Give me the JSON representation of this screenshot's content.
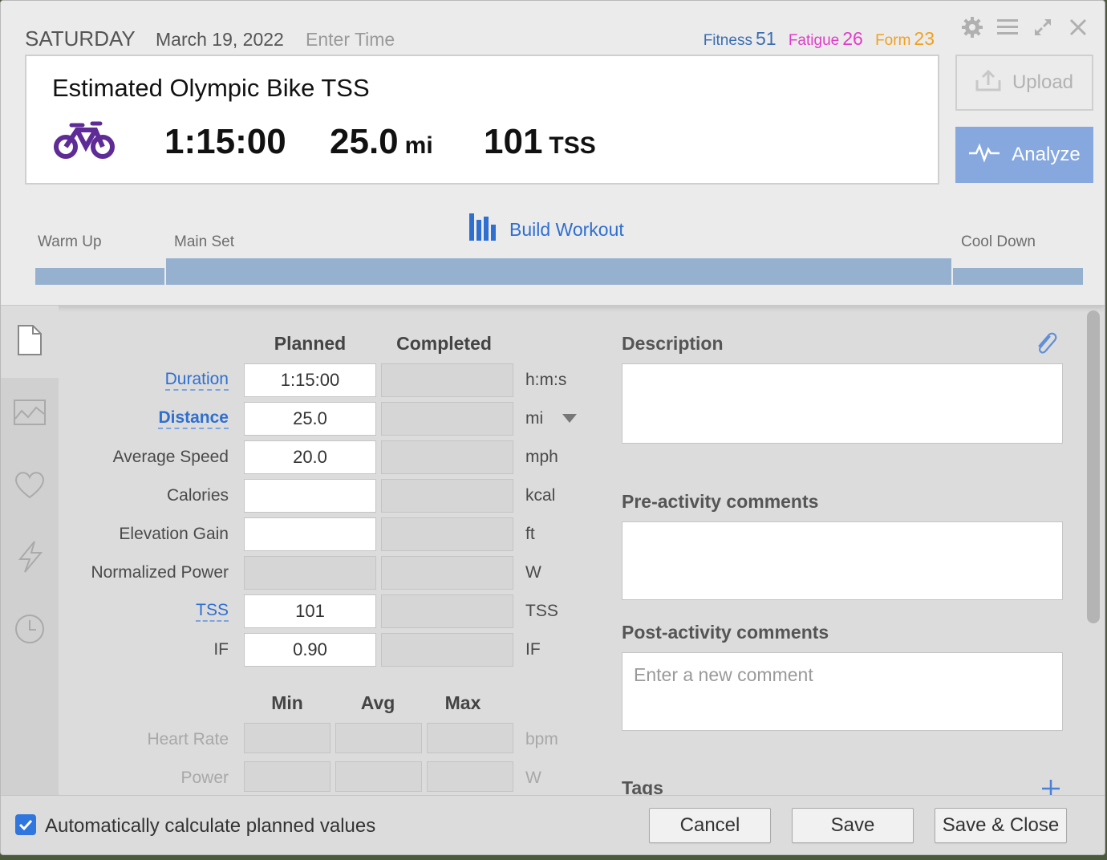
{
  "header": {
    "day_name": "SATURDAY",
    "date": "March 19, 2022",
    "time_placeholder": "Enter Time",
    "metrics": {
      "fitness_label": "Fitness",
      "fitness_value": "51",
      "fatigue_label": "Fatigue",
      "fatigue_value": "26",
      "form_label": "Form",
      "form_value": "23"
    },
    "colors": {
      "fitness": "#3b6db3",
      "fatigue": "#e03cc8",
      "form": "#f0a020"
    }
  },
  "summary": {
    "title": "Estimated Olympic Bike TSS",
    "duration": "1:15:00",
    "distance_value": "25.0",
    "distance_unit": "mi",
    "tss_value": "101",
    "tss_unit": "TSS",
    "sport_icon": "bike-icon",
    "sport_color": "#5e2b97"
  },
  "buttons": {
    "upload": "Upload",
    "analyze": "Analyze"
  },
  "build": {
    "link": "Build Workout",
    "segments": {
      "warm_up": "Warm Up",
      "main_set": "Main Set",
      "cool_down": "Cool Down"
    }
  },
  "table": {
    "planned_header": "Planned",
    "completed_header": "Completed",
    "rows": [
      {
        "label": "Duration",
        "planned": "1:15:00",
        "completed": "",
        "unit": "h:m:s"
      },
      {
        "label": "Distance",
        "planned": "25.0",
        "completed": "",
        "unit": "mi"
      },
      {
        "label": "Average Speed",
        "planned": "20.0",
        "completed": "",
        "unit": "mph"
      },
      {
        "label": "Calories",
        "planned": "",
        "completed": "",
        "unit": "kcal"
      },
      {
        "label": "Elevation Gain",
        "planned": "",
        "completed": "",
        "unit": "ft"
      },
      {
        "label": "Normalized Power",
        "planned": "",
        "completed": "",
        "unit": "W"
      },
      {
        "label": "TSS",
        "planned": "101",
        "completed": "",
        "unit": "TSS"
      },
      {
        "label": "IF",
        "planned": "0.90",
        "completed": "",
        "unit": "IF"
      }
    ],
    "range_headers": {
      "min": "Min",
      "avg": "Avg",
      "max": "Max"
    },
    "range_rows": [
      {
        "label": "Heart Rate",
        "unit": "bpm"
      },
      {
        "label": "Power",
        "unit": "W"
      }
    ]
  },
  "right": {
    "description_title": "Description",
    "pre_title": "Pre-activity comments",
    "post_title": "Post-activity comments",
    "post_placeholder": "Enter a new comment",
    "tags_title": "Tags"
  },
  "footer": {
    "auto_calc_label": "Automatically calculate planned values",
    "auto_calc_checked": true,
    "cancel": "Cancel",
    "save": "Save",
    "save_close": "Save & Close"
  }
}
